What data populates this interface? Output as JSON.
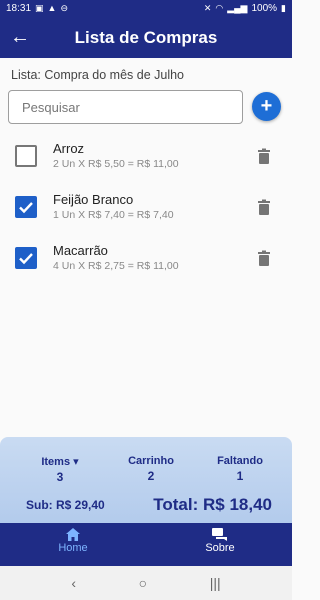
{
  "statusbar": {
    "time": "18:31",
    "battery": "100%"
  },
  "appbar": {
    "back_label": "←",
    "title": "Lista de Compras"
  },
  "list_name": "Lista: Compra do mês de Julho",
  "search": {
    "placeholder": "Pesquisar"
  },
  "add_button": "+",
  "items": [
    {
      "name": "Arroz",
      "detail": "2 Un X R$ 5,50 = R$ 11,00",
      "checked": false
    },
    {
      "name": "Feijão Branco",
      "detail": "1 Un X R$ 7,40 = R$ 7,40",
      "checked": true
    },
    {
      "name": "Macarrão",
      "detail": "4 Un X R$ 2,75 = R$ 11,00",
      "checked": true
    }
  ],
  "summary": {
    "items_label": "Items ▾",
    "items_value": "3",
    "cart_label": "Carrinho",
    "cart_value": "2",
    "missing_label": "Faltando",
    "missing_value": "1",
    "sub_total": "Sub: R$ 29,40",
    "total": "Total: R$ 18,40"
  },
  "nav": {
    "home": "Home",
    "about": "Sobre"
  },
  "sysnav": {
    "back": "‹",
    "home": "○",
    "recents": "|||"
  },
  "colors": {
    "primary": "#1f2c86",
    "accent": "#1e6ed6",
    "checkbox": "#1e5fc8",
    "summary_bg": "#c9dbf2",
    "nav_active": "#7db4ff"
  }
}
